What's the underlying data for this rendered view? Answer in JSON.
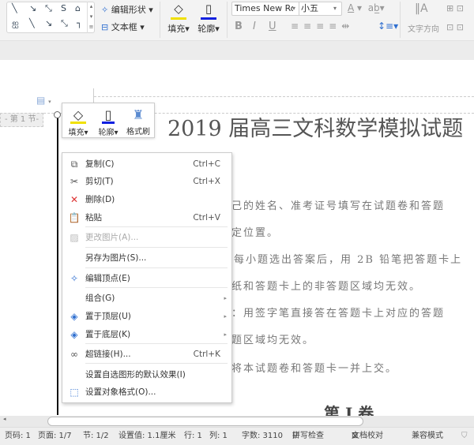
{
  "ribbon": {
    "edit_shape": "编辑形状",
    "text_box": "文本框",
    "fill": "填充",
    "outline": "轮廓",
    "font_name": "Times New Ro",
    "font_size": "小五",
    "text_direction": "文字方向",
    "bold": "B",
    "italic": "I",
    "underline": "U"
  },
  "document": {
    "section_label": "- 第 1 节-",
    "title": "2019 届高三文科数学模拟试题",
    "lines": [
      "己的姓名、准考证号填写在试题卷和答题",
      "定位置。",
      "每小题选出答案后，用 2B 铅笔把答题卡上",
      "纸和答题卡上的非答题区域均无效。",
      "：用签字笔直接答在答题卡上对应的答题",
      "题区域均无效。",
      "将本试题卷和答题卡一并上交。"
    ],
    "heading": "第 I 卷"
  },
  "mini_toolbar": {
    "fill": "填充",
    "outline": "轮廓",
    "format_painter": "格式刷"
  },
  "context_menu": {
    "items": [
      {
        "label": "复制(C)",
        "shortcut": "Ctrl+C",
        "icon": "copy-icon"
      },
      {
        "label": "剪切(T)",
        "shortcut": "Ctrl+X",
        "icon": "scissors-icon"
      },
      {
        "label": "删除(D)",
        "shortcut": "",
        "icon": "delete-x-icon"
      },
      {
        "label": "粘贴",
        "shortcut": "Ctrl+V",
        "icon": "paste-icon"
      },
      {
        "label": "更改图片(A)...",
        "shortcut": "",
        "icon": "change-picture-icon"
      },
      {
        "label": "另存为图片(S)...",
        "shortcut": ""
      },
      {
        "label": "编辑顶点(E)",
        "shortcut": "",
        "icon": "edit-points-icon"
      },
      {
        "label": "组合(G)",
        "shortcut": ""
      },
      {
        "label": "置于顶层(U)",
        "shortcut": "",
        "icon": "bring-front-icon"
      },
      {
        "label": "置于底层(K)",
        "shortcut": "",
        "icon": "send-back-icon"
      },
      {
        "label": "超链接(H)...",
        "shortcut": "Ctrl+K",
        "icon": "link-icon"
      },
      {
        "label": "设置自选图形的默认效果(I)",
        "shortcut": ""
      },
      {
        "label": "设置对象格式(O)...",
        "shortcut": "",
        "icon": "format-object-icon"
      }
    ]
  },
  "status": {
    "page_code": "页码: 1",
    "pages": "页面: 1/7",
    "section": "节: 1/2",
    "setting": "设置值: 1.1厘米",
    "row": "行: 1",
    "col": "列: 1",
    "words": "字数: 3110",
    "spell_check": "拼写检查",
    "doc_proof": "文档校对",
    "compat_mode": "兼容模式"
  },
  "colors": {
    "fill_bar": "#f0e000",
    "outline_bar": "#1020e0",
    "accent": "#2f6fd0"
  }
}
